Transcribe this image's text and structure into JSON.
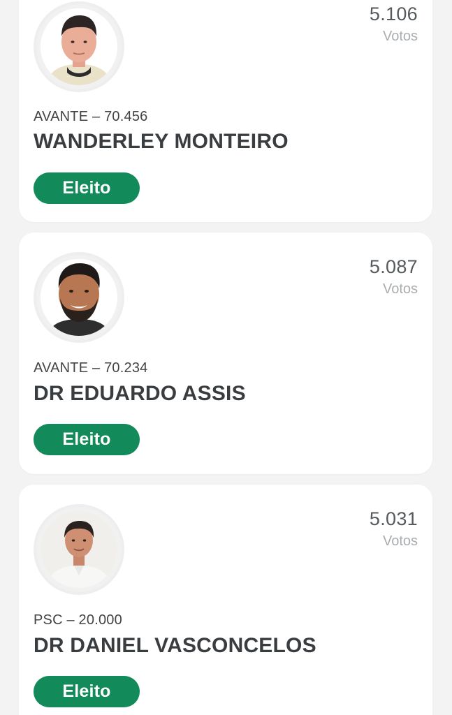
{
  "colors": {
    "background": "#f3f3f3",
    "card": "#ffffff",
    "elected_badge": "#128a5a",
    "votes_count": "#555a5d",
    "votes_label": "#a9adb0",
    "name": "#3a3d40"
  },
  "candidates": [
    {
      "votes": "5.106",
      "votes_label": "Votos",
      "party_number": "AVANTE – 70.456",
      "name": "WANDERLEY MONTEIRO",
      "status": "Eleito",
      "photo_icon": "candidate-photo"
    },
    {
      "votes": "5.087",
      "votes_label": "Votos",
      "party_number": "AVANTE – 70.234",
      "name": "DR EDUARDO ASSIS",
      "status": "Eleito",
      "photo_icon": "candidate-photo"
    },
    {
      "votes": "5.031",
      "votes_label": "Votos",
      "party_number": "PSC – 20.000",
      "name": "DR DANIEL VASCONCELOS",
      "status": "Eleito",
      "photo_icon": "candidate-photo"
    }
  ]
}
